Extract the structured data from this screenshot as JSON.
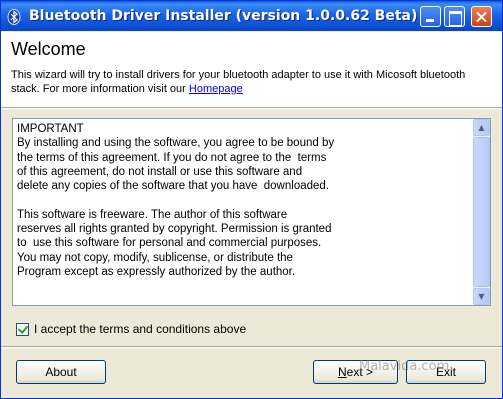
{
  "window": {
    "title": "Bluetooth Driver Installer (version 1.0.0.62 Beta)",
    "title_icon": "bluetooth-icon"
  },
  "header": {
    "heading": "Welcome",
    "intro_text": "This wizard will try to install drivers for your bluetooth adapter to use it with Micosoft bluetooth stack.  For more information visit our ",
    "homepage_link": "Homepage"
  },
  "license": {
    "text": "IMPORTANT\nBy installing and using the software, you agree to be bound by\nthe terms of this agreement. If you do not agree to the  terms\nof this agreement, do not install or use this software and\ndelete any copies of the software that you have  downloaded.\n\nThis software is freeware. The author of this software\nreserves all rights granted by copyright. Permission is granted\nto  use this software for personal and commercial purposes.\nYou may not copy, modify, sublicense, or distribute the\nProgram except as expressly authorized by the author."
  },
  "accept": {
    "label": "I accept the terms and conditions above",
    "checked": true
  },
  "buttons": {
    "about": "About",
    "next_mnemonic": "N",
    "next_rest": "ext >",
    "exit": "Exit"
  },
  "watermark": "Malavida.com"
}
